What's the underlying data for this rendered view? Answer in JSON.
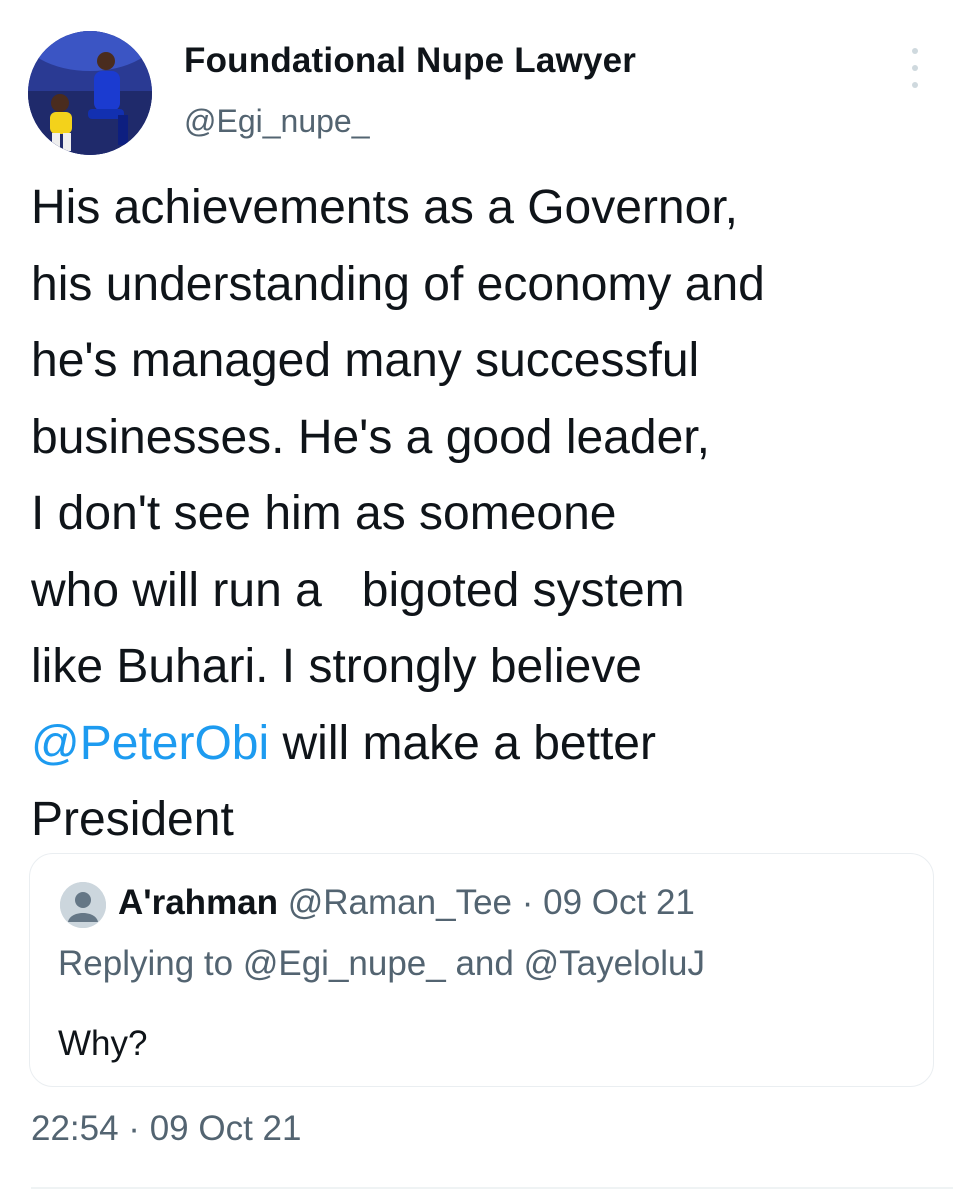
{
  "author": {
    "display_name": "Foundational Nupe Lawyer",
    "handle": "@Egi_nupe_",
    "avatar": "profile-photo"
  },
  "more_icon": "more-options-icon",
  "tweet": {
    "lines": [
      "His achievements as a Governor,",
      "his understanding of economy and",
      "he's managed many successful",
      "businesses. He's a good leader,",
      "I don't see him as someone",
      "who will run a   bigoted system",
      "like Buhari. I strongly believe"
    ],
    "mention": "@PeterObi",
    "after_mention": " will make a better",
    "last_line": "President"
  },
  "quote": {
    "avatar": "default-user-icon",
    "name": "A'rahman",
    "meta": " @Raman_Tee · 09 Oct 21",
    "replying_to": "Replying to @Egi_nupe_ and @TayeloluJ",
    "body": "Why?"
  },
  "timestamp": "22:54 · 09 Oct 21",
  "colors": {
    "link": "#1d9bf0",
    "text": "#0f1419",
    "secondary": "#536471",
    "border": "#eaeef1"
  }
}
